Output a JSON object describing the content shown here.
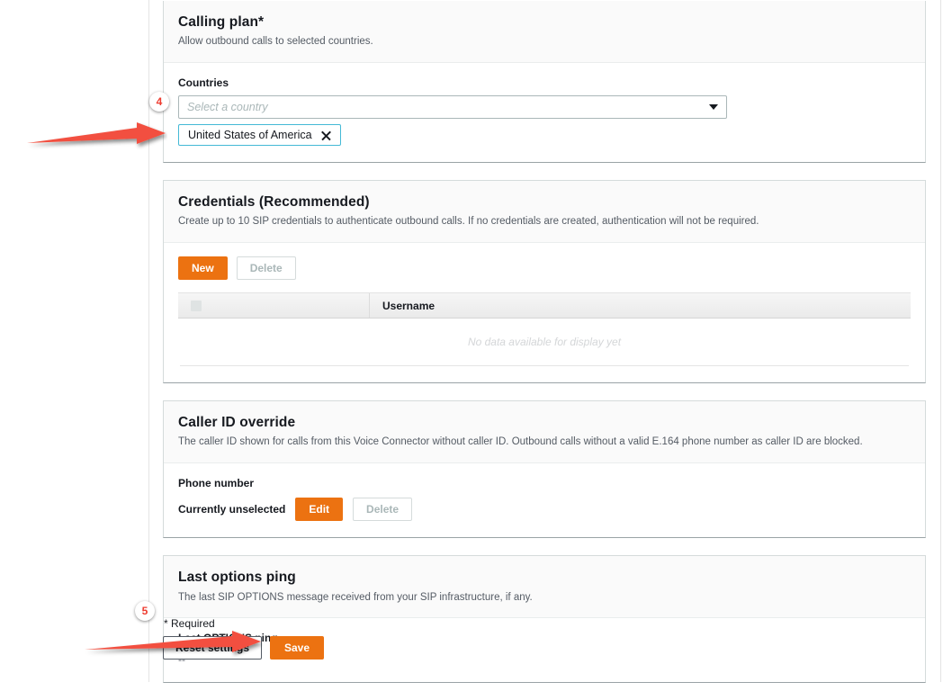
{
  "sections": [
    {
      "id": "calling-plan",
      "title": "Calling plan*",
      "description": "Allow outbound calls to selected countries.",
      "countries_label": "Countries",
      "select_placeholder": "Select a country",
      "selected_country": "United States of America",
      "remove_icon": "close-icon",
      "dropdown_icon": "chevron-down-icon"
    },
    {
      "id": "credentials",
      "title": "Credentials (Recommended)",
      "description": "Create up to 10 SIP credentials to authenticate outbound calls. If no credentials are created, authentication will not be required.",
      "new_label": "New",
      "delete_label": "Delete",
      "columns": [
        "",
        "Username"
      ],
      "rows": [],
      "empty_text": "No data available for display yet"
    },
    {
      "id": "caller-id-override",
      "title": "Caller ID override",
      "description": "The caller ID shown for calls from this Voice Connector without caller ID. Outbound calls without a valid E.164 phone number as caller ID are blocked.",
      "phone_label": "Phone number",
      "phone_value": "Currently unselected",
      "edit_label": "Edit",
      "delete_label": "Delete"
    },
    {
      "id": "last-options-ping",
      "title": "Last options ping",
      "description": "The last SIP OPTIONS message received from your SIP infrastructure, if any.",
      "ping_label": "Last OPTIONS ping",
      "ping_value": "--"
    }
  ],
  "footer": {
    "required_note": "* Required",
    "reset_label": "Reset settings",
    "save_label": "Save"
  },
  "annotations": {
    "markers": [
      {
        "id": "4",
        "label": "4"
      },
      {
        "id": "5",
        "label": "5"
      }
    ],
    "arrow_color": "#f2503f",
    "marker_color": "#ee3b2f"
  },
  "colors": {
    "primary": "#ec7211",
    "token_border": "#44b9d6",
    "panel_border": "#d5dbdb",
    "text": "#16191f",
    "muted": "#545b64"
  }
}
